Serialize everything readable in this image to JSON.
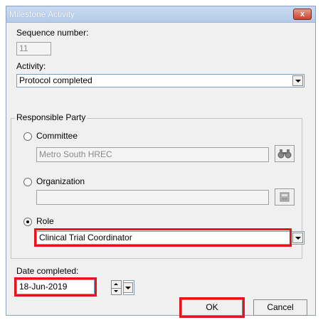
{
  "window": {
    "title": "Milestone Activity",
    "close_label": "x"
  },
  "sequence": {
    "label": "Sequence number:",
    "value": "11"
  },
  "activity": {
    "label": "Activity:",
    "value": "Protocol completed"
  },
  "responsible_party": {
    "legend": "Responsible Party",
    "committee": {
      "label": "Committee",
      "value": "Metro South HREC",
      "selected": false
    },
    "organization": {
      "label": "Organization",
      "value": "",
      "selected": false
    },
    "role": {
      "label": "Role",
      "value": "Clinical Trial Coordinator",
      "selected": true
    }
  },
  "date": {
    "label": "Date completed:",
    "value": "18-Jun-2019"
  },
  "buttons": {
    "ok": "OK",
    "cancel": "Cancel"
  },
  "colors": {
    "highlight": "#e8141b",
    "title_bar": "#b4cbe9",
    "close_button": "#c8452d"
  },
  "icons": {
    "committee_lookup": "binoculars-icon",
    "organization_lookup": "lookup-icon"
  }
}
